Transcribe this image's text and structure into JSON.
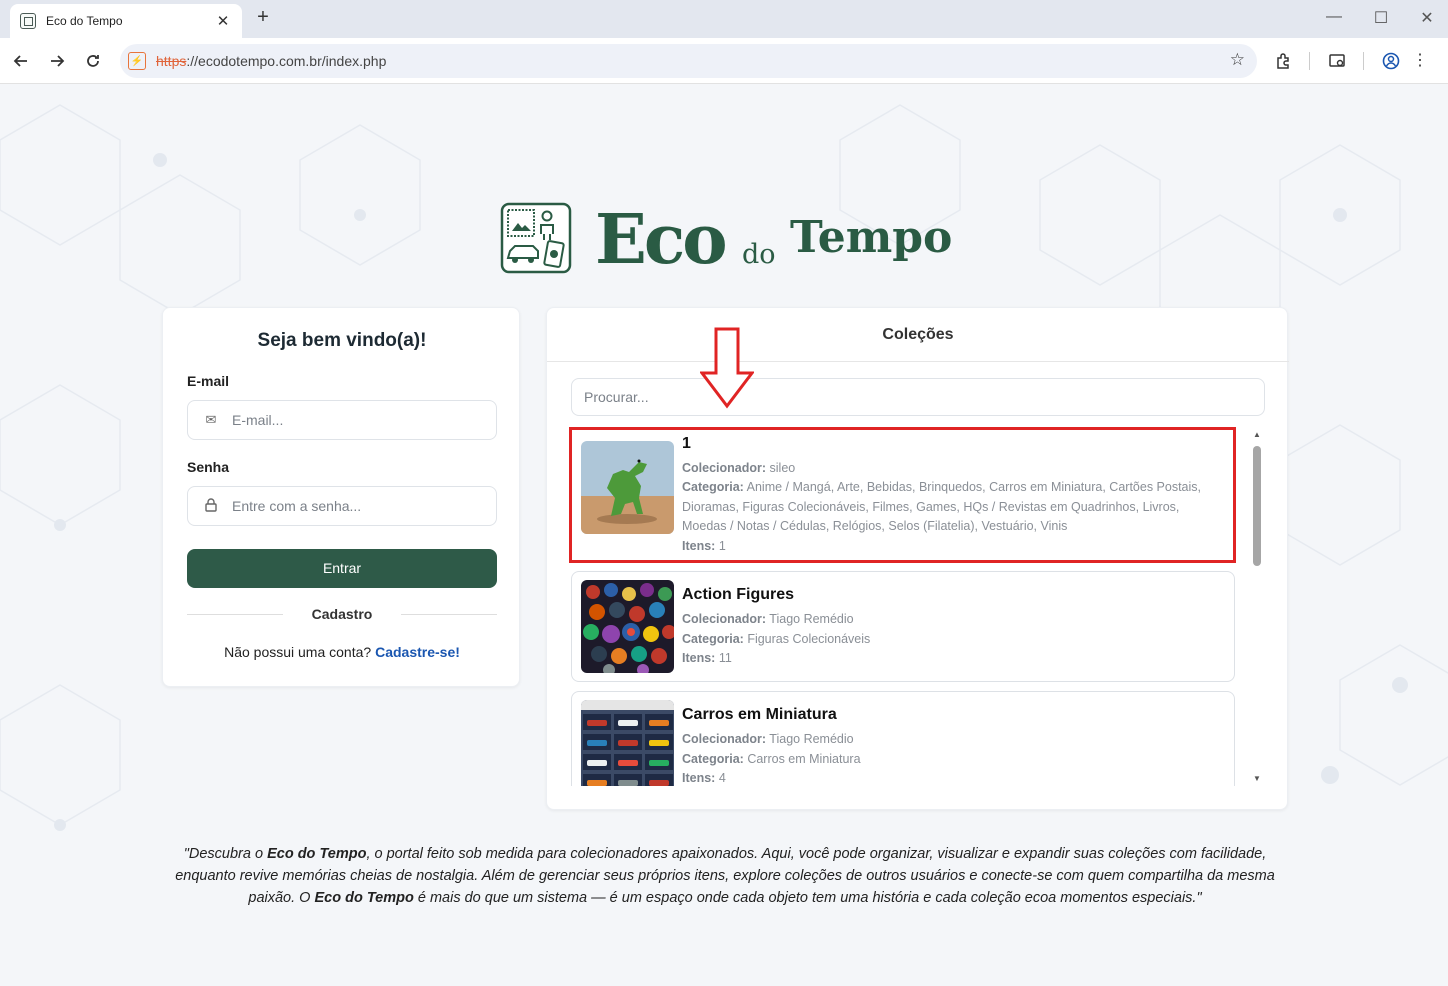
{
  "browser": {
    "tab_title": "Eco do Tempo",
    "tab_close": "✕",
    "new_tab": "+",
    "url_scheme": "https",
    "url_rest": "://ecodotempo.com.br/index.php",
    "win_min": "—",
    "win_max": "☐",
    "win_close": "✕"
  },
  "logo": {
    "eco": "Eco",
    "do": "do",
    "tempo": "Tempo"
  },
  "login": {
    "title": "Seja bem vindo(a)!",
    "email_label": "E-mail",
    "email_placeholder": "E-mail...",
    "password_label": "Senha",
    "password_placeholder": "Entre com a senha...",
    "submit_label": "Entrar",
    "divider": "Cadastro",
    "signup_text": "Não possui uma conta?",
    "signup_link": "Cadastre-se!"
  },
  "collections": {
    "header": "Coleções",
    "search_placeholder": "Procurar...",
    "items": [
      {
        "name": "1",
        "collector_label": "Colecionador:",
        "collector": "sileo",
        "category_label": "Categoria:",
        "category": "Anime / Mangá, Arte, Bebidas, Brinquedos, Carros em Miniatura, Cartões Postais, Dioramas, Figuras Colecionáveis, Filmes, Games, HQs / Revistas em Quadrinhos, Livros, Moedas / Notas / Cédulas, Relógios, Selos (Filatelia), Vestuário, Vinis",
        "items_label": "Itens:",
        "items": "1"
      },
      {
        "name": "Action Figures",
        "collector_label": "Colecionador:",
        "collector": "Tiago Remédio",
        "category_label": "Categoria:",
        "category": "Figuras Colecionáveis",
        "items_label": "Itens:",
        "items": "11"
      },
      {
        "name": "Carros em Miniatura",
        "collector_label": "Colecionador:",
        "collector": "Tiago Remédio",
        "category_label": "Categoria:",
        "category": "Carros em Miniatura",
        "items_label": "Itens:",
        "items": "4"
      }
    ]
  },
  "footer": {
    "q1": "\"Descubra o ",
    "b1": "Eco do Tempo",
    "q2": ", o portal feito sob medida para colecionadores apaixonados. Aqui, você pode organizar, visualizar e expandir suas coleções com facilidade, enquanto revive memórias cheias de nostalgia. Além de gerenciar seus próprios itens, explore coleções de outros usuários e conecte-se com quem compartilha da mesma paixão. O ",
    "b2": "Eco do Tempo",
    "q3": " é mais do que um sistema — é um espaço onde cada objeto tem uma história e cada coleção ecoa momentos especiais.\""
  },
  "colors": {
    "brand": "#2a5b44",
    "button": "#2e5a48",
    "link": "#1a56b0",
    "highlight": "#e02424"
  }
}
